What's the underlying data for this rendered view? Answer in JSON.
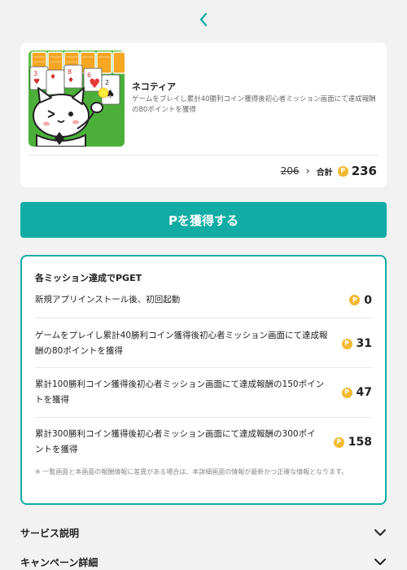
{
  "app": {
    "name": "ネコティア",
    "description": "ゲームをプレイし累計40勝利コイン獲得後初心者ミッション画面にて達成報酬の80ポイントを獲得"
  },
  "points": {
    "old": "206",
    "total_label": "合計",
    "total": "236",
    "coin_symbol": "P"
  },
  "get_button_label": "Pを獲得する",
  "missions": {
    "title": "各ミッション達成でPGET",
    "items": [
      {
        "text": "新規アプリインストール後、初回起動",
        "points": "0"
      },
      {
        "text": "ゲームをプレイし累計40勝利コイン獲得後初心者ミッション画面にて達成報酬の80ポイントを獲得",
        "points": "31"
      },
      {
        "text": "累計100勝利コイン獲得後初心者ミッション画面にて達成報酬の150ポイントを獲得",
        "points": "47"
      },
      {
        "text": "累計300勝利コイン獲得後初心者ミッション画面にて達成報酬の300ポイントを獲得",
        "points": "158"
      }
    ],
    "note": "※ 一覧画面と本画面の報酬情報に差異がある場合は、本詳細画面の情報が最新かつ正確な情報となります。"
  },
  "accordions": [
    {
      "label": "サービス説明"
    },
    {
      "label": "キャンペーン詳細"
    }
  ],
  "colors": {
    "accent": "#13aca4",
    "coin": "#f2b92e"
  },
  "icons": {
    "back": "chevron-left-icon",
    "expand": "chevron-down-icon",
    "coin": "point-coin-icon"
  }
}
